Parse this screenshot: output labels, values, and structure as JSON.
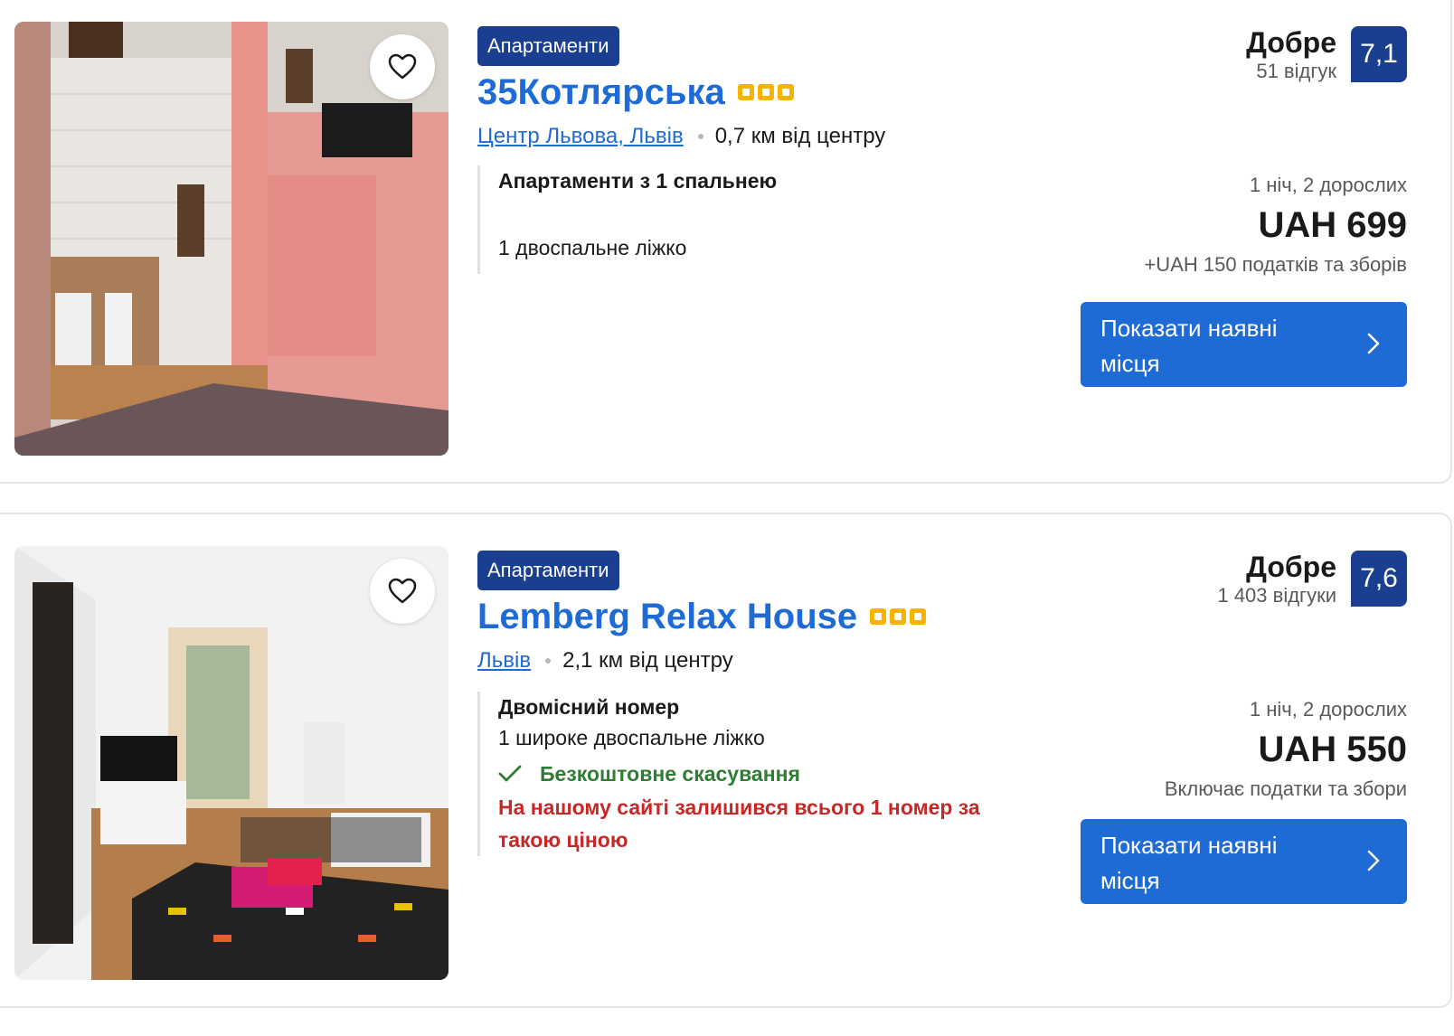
{
  "listings": [
    {
      "type_badge": "Апартаменти",
      "name": "35Котлярська",
      "stars": 3,
      "location_link": "Центр Львова, Львів",
      "distance": "0,7 км від центру",
      "room_name": "Апартаменти з 1 спальнею",
      "bed": "1 двоспальне ліжко",
      "rating_word": "Добре",
      "reviews": "51 відгук",
      "score": "7,1",
      "nights": "1 ніч, 2 дорослих",
      "price": "UAH 699",
      "taxes": "+UAH 150 податків та зборів",
      "cta": "Показати наявні місця"
    },
    {
      "type_badge": "Апартаменти",
      "name": "Lemberg Relax House",
      "stars": 3,
      "location_link": "Львів",
      "distance": "2,1 км від центру",
      "room_name": "Двомісний номер",
      "bed": "1 широке двоспальне ліжко",
      "free_cancellation": "Безкоштовне скасування",
      "availability_note": "На нашому сайті залишився всього 1 номер за такою ціною",
      "rating_word": "Добре",
      "reviews": "1 403 відгуки",
      "score": "7,6",
      "nights": "1 ніч, 2 дорослих",
      "price": "UAH 550",
      "taxes": "Включає податки та збори",
      "cta": "Показати наявні місця"
    }
  ],
  "colors": {
    "link_blue": "#1f6bd6",
    "badge_navy": "#1a3f91",
    "star_gold": "#f6b400",
    "success_green": "#2e7d32",
    "urgent_red": "#c62828"
  },
  "icons": [
    "heart-icon",
    "star-icon",
    "check-icon",
    "chevron-right-icon"
  ]
}
